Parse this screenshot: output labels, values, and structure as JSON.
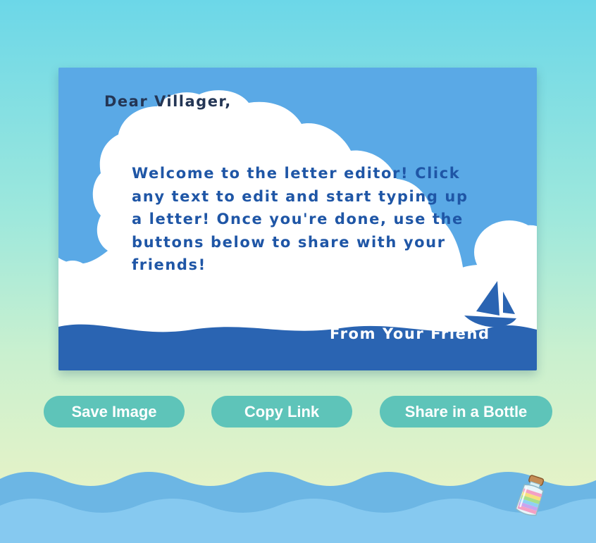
{
  "letter": {
    "greeting": "Dear Villager,",
    "body": "Welcome to the letter editor! Click any text to edit and start typing up a letter! Once you're done, use the buttons below to share with your friends!",
    "signature": "From Your Friend"
  },
  "actions": {
    "save_label": "Save Image",
    "copy_label": "Copy Link",
    "bottle_label": "Share in a Bottle"
  },
  "colors": {
    "sky": "#5aa9e6",
    "cloud": "#ffffff",
    "ocean": "#2a64b2",
    "button": "#5ec4b9",
    "greeting_text": "#243655",
    "body_text": "#1f56a6"
  },
  "icons": {
    "sailboat": "sailboat-icon",
    "bottle": "message-bottle-icon"
  }
}
